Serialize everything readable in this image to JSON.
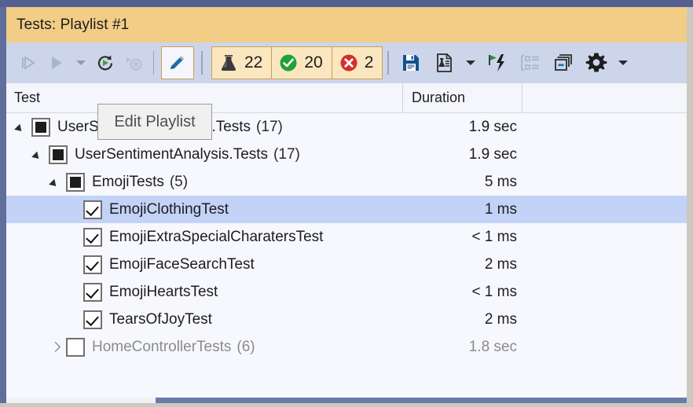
{
  "window": {
    "title": "Tests: Playlist #1"
  },
  "toolbar": {
    "buttons": [
      {
        "name": "run-all-tests-button",
        "icon": "run-all-icon",
        "enabled": false
      },
      {
        "name": "run-button",
        "icon": "run-icon",
        "enabled": false
      },
      {
        "name": "run-dropdown-button",
        "icon": "chevron-down-icon",
        "enabled": false
      },
      {
        "name": "repeat-last-run-button",
        "icon": "repeat-run-icon",
        "enabled": true
      },
      {
        "name": "stop-button",
        "icon": "stop-icon",
        "enabled": false
      }
    ],
    "edit_playlist": {
      "name": "edit-playlist-button",
      "icon": "pencil-icon",
      "tooltip": "Edit Playlist"
    },
    "badges": [
      {
        "name": "total-tests-badge",
        "icon": "flask-icon",
        "count": "22",
        "color": "#2e2e2e"
      },
      {
        "name": "passed-tests-badge",
        "icon": "check-circle-icon",
        "count": "20",
        "color": "#22a03a"
      },
      {
        "name": "failed-tests-badge",
        "icon": "error-circle-icon",
        "count": "2",
        "color": "#d32f2f"
      }
    ],
    "right_buttons": [
      {
        "name": "save-playlist-button",
        "icon": "save-icon",
        "enabled": true
      },
      {
        "name": "test-settings-button",
        "icon": "test-document-icon",
        "enabled": true
      },
      {
        "name": "test-settings-dropdown-button",
        "icon": "chevron-down-icon",
        "enabled": true
      },
      {
        "name": "run-until-failure-button",
        "icon": "run-flash-icon",
        "enabled": true
      },
      {
        "name": "group-by-button",
        "icon": "hierarchy-list-icon",
        "enabled": false
      },
      {
        "name": "copy-button",
        "icon": "copy-windows-icon",
        "enabled": true
      },
      {
        "name": "options-button",
        "icon": "gear-icon",
        "enabled": true
      },
      {
        "name": "options-dropdown-button",
        "icon": "chevron-down-icon",
        "enabled": true
      }
    ]
  },
  "grid": {
    "columns": [
      {
        "name": "column-test",
        "label": "Test"
      },
      {
        "name": "column-duration",
        "label": "Duration"
      },
      {
        "name": "column-extra",
        "label": ""
      }
    ],
    "rows": [
      {
        "name": "UserSentimentAnalysis.Tests",
        "count": "(17)",
        "duration": "1.9 sec",
        "indent": 0,
        "twisty": "expanded",
        "checkbox": "mixed",
        "selected": false,
        "dim": false
      },
      {
        "name": "UserSentimentAnalysis.Tests",
        "count": "(17)",
        "duration": "1.9 sec",
        "indent": 1,
        "twisty": "expanded",
        "checkbox": "mixed",
        "selected": false,
        "dim": false
      },
      {
        "name": "EmojiTests",
        "count": "(5)",
        "duration": "5 ms",
        "indent": 2,
        "twisty": "expanded",
        "checkbox": "mixed",
        "selected": false,
        "dim": false
      },
      {
        "name": "EmojiClothingTest",
        "count": "",
        "duration": "1 ms",
        "indent": 3,
        "twisty": "none",
        "checkbox": "checked",
        "selected": true,
        "dim": false
      },
      {
        "name": "EmojiExtraSpecialCharatersTest",
        "count": "",
        "duration": "< 1 ms",
        "indent": 3,
        "twisty": "none",
        "checkbox": "checked",
        "selected": false,
        "dim": false
      },
      {
        "name": "EmojiFaceSearchTest",
        "count": "",
        "duration": "2 ms",
        "indent": 3,
        "twisty": "none",
        "checkbox": "checked",
        "selected": false,
        "dim": false
      },
      {
        "name": "EmojiHeartsTest",
        "count": "",
        "duration": "< 1 ms",
        "indent": 3,
        "twisty": "none",
        "checkbox": "checked",
        "selected": false,
        "dim": false
      },
      {
        "name": "TearsOfJoyTest",
        "count": "",
        "duration": "2 ms",
        "indent": 3,
        "twisty": "none",
        "checkbox": "checked",
        "selected": false,
        "dim": false
      },
      {
        "name": "HomeControllerTests",
        "count": "(6)",
        "duration": "1.8 sec",
        "indent": 2,
        "twisty": "collapsed",
        "checkbox": "empty",
        "selected": false,
        "dim": true
      }
    ]
  },
  "scrollbar": {
    "name": "horizontal-scrollbar"
  },
  "colors": {
    "title_bar": "#f2cd86",
    "toolbar": "#cdd5ea",
    "selection": "#c3d2f7",
    "badge_bg": "#fae6bf",
    "badge_border": "#c8a053",
    "pass_green": "#22a03a",
    "fail_red": "#d32f2f",
    "chrome_blue": "#546091"
  }
}
